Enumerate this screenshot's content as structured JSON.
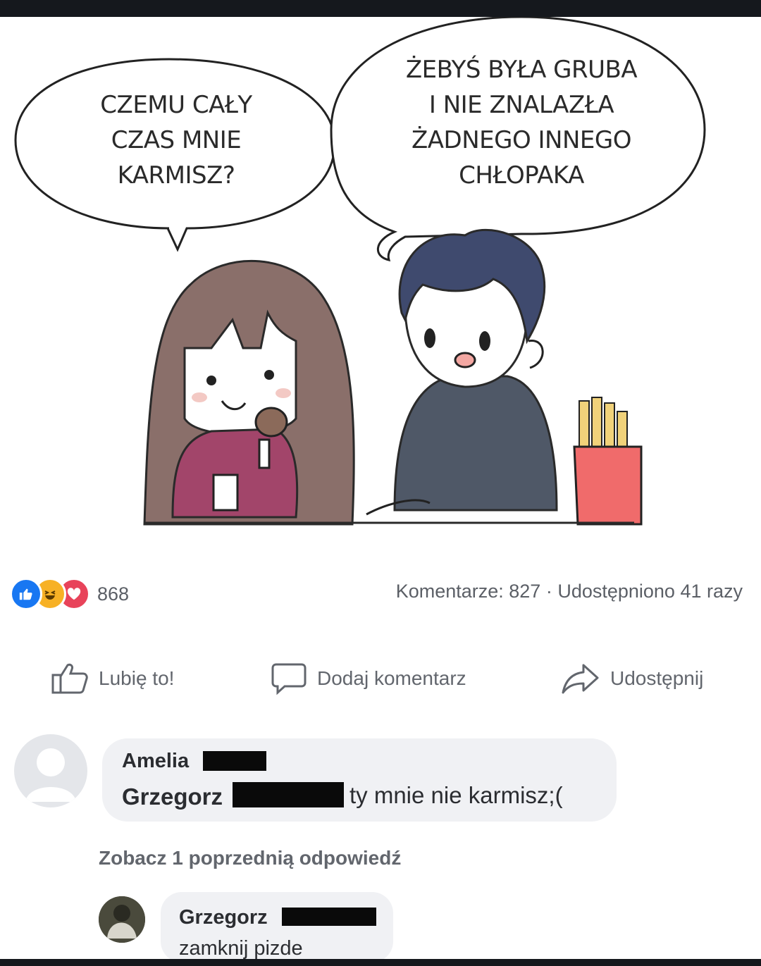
{
  "comic": {
    "left_bubble": [
      "CZEMU CAŁY",
      "CZAS MNIE",
      "KARMISZ?"
    ],
    "right_bubble": [
      "ŻEBYŚ BYŁA GRUBA",
      "I NIE ZNALAZŁA",
      "ŻADNEGO INNEGO",
      "CHŁOPAKA"
    ]
  },
  "post": {
    "reaction_icons": [
      "like-icon",
      "haha-icon",
      "love-icon"
    ],
    "reaction_count": "868",
    "stats": "Komentarze: 827 · Udostępniono 41 razy",
    "actions": {
      "like": "Lubię to!",
      "comment": "Dodaj komentarz",
      "share": "Udostępnij"
    }
  },
  "comments": [
    {
      "author": "Amelia",
      "mention": "Grzegorz",
      "text": "ty mnie nie karmisz;("
    }
  ],
  "more_replies": "Zobacz 1 poprzednią odpowiedź",
  "reply": {
    "author": "Grzegorz",
    "text": "zamknij pizde"
  },
  "colors": {
    "accent_like": "#1877f2",
    "haha": "#f7b125",
    "love": "#e8435a",
    "muted_text": "#62666d",
    "comment_bg": "#f0f1f4"
  }
}
